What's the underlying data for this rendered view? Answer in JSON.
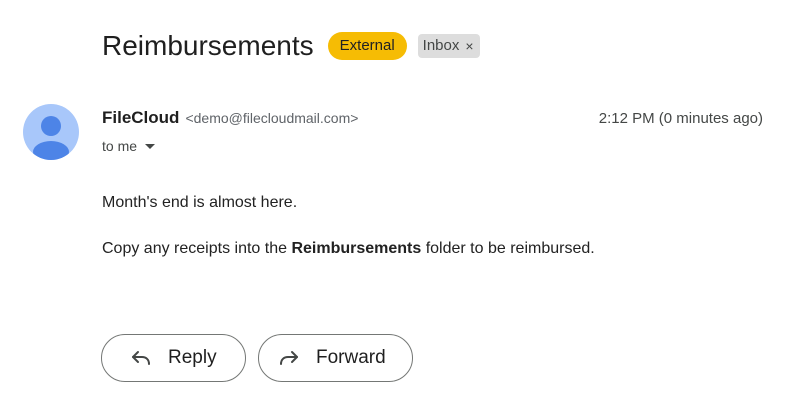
{
  "email": {
    "subject": "Reimbursements",
    "labels": {
      "external": "External",
      "inbox": "Inbox",
      "inbox_remove": "×"
    },
    "sender": {
      "name": "FileCloud",
      "email": "<demo@filecloudmail.com>"
    },
    "timestamp": "2:12 PM (0 minutes ago)",
    "recipient_text": "to me",
    "body": {
      "line1": "Month's end is almost here.",
      "line2_prefix": "Copy any receipts into the ",
      "line2_bold": "Reimbursements",
      "line2_suffix": " folder to be reimbursed."
    }
  },
  "actions": {
    "reply_label": "Reply",
    "forward_label": "Forward"
  },
  "icons": {
    "avatar": "person-icon",
    "recipient_toggle": "caret-down-icon",
    "reply": "reply-arrow-icon",
    "forward": "forward-arrow-icon"
  },
  "colors": {
    "external_badge": "#f6bc04",
    "inbox_badge": "#dddddd",
    "avatar_bg": "#a8c7fa",
    "avatar_fg": "#4d84e7"
  }
}
